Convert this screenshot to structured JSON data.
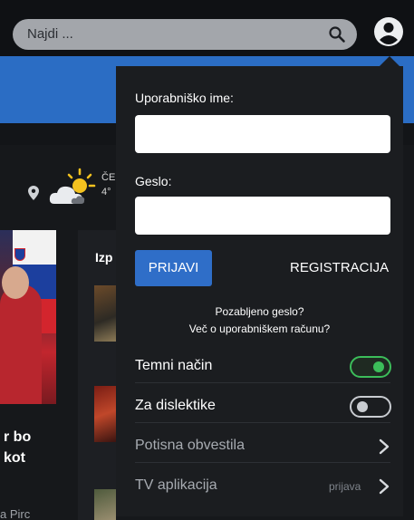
{
  "header": {
    "search_placeholder": "Najdi ..."
  },
  "weather": {
    "day": "ČE",
    "temp": "4°"
  },
  "background": {
    "hero_title_line1": "r bo",
    "hero_title_line2": "kot",
    "hero_author": "a Pirc",
    "side_heading": "Izp"
  },
  "login_panel": {
    "username_label": "Uporabniško ime:",
    "password_label": "Geslo:",
    "login_button": "PRIJAVI",
    "register_link": "REGISTRACIJA",
    "forgot_password": "Pozabljeno geslo?",
    "account_info": "Več o uporabniškem računu?",
    "dark_mode_label": "Temni način",
    "dark_mode_on": true,
    "dyslexia_label": "Za dislektike",
    "dyslexia_on": false,
    "push_label": "Potisna obvestila",
    "tv_label": "TV aplikacija",
    "tv_status": "prijava"
  },
  "colors": {
    "accent_blue": "#2b6dc4",
    "toggle_on": "#3cbd5a",
    "panel_bg": "#1b1d20"
  },
  "icons": {
    "search": "search-icon",
    "user": "user-icon",
    "location": "pin-icon",
    "weather": "partly-cloudy-icon",
    "chevron": "chevron-right-icon"
  }
}
